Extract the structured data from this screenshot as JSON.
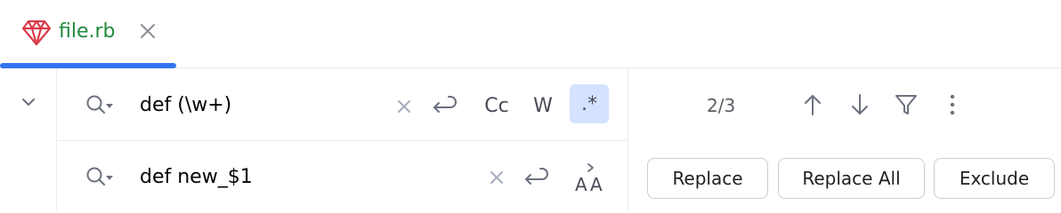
{
  "tab": {
    "filename": "file.rb",
    "icon": "ruby-gem-icon",
    "active_color": "#3574f0",
    "label_color": "#208a3c"
  },
  "find": {
    "value": "def (\\w+)",
    "options": {
      "case_label": "Cc",
      "word_label": "W",
      "regex_label": ".*",
      "regex_active": true
    },
    "match_count": "2/3"
  },
  "replace": {
    "value": "def new_$1",
    "buttons": {
      "replace": "Replace",
      "replace_all": "Replace All",
      "exclude": "Exclude"
    }
  }
}
